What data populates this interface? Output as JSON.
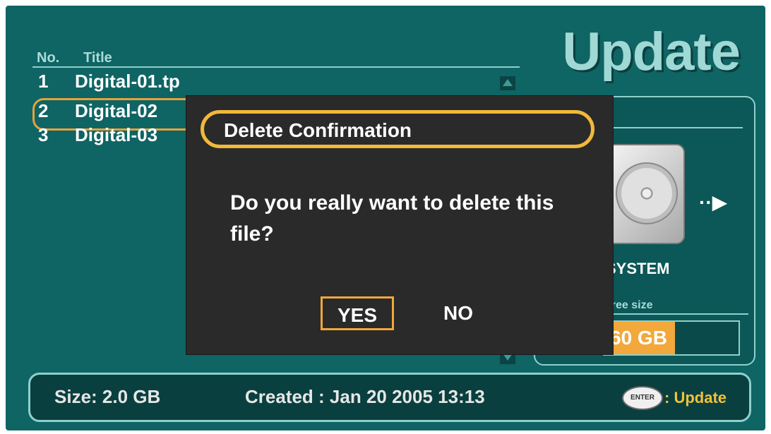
{
  "header": {
    "title": "Update"
  },
  "list": {
    "col_no": "No.",
    "col_title": "Title",
    "items": [
      {
        "no": "1",
        "title": "Digital-01.tp"
      },
      {
        "no": "2",
        "title": "Digital-02"
      },
      {
        "no": "3",
        "title": "Digital-03"
      }
    ],
    "selected_index": 1
  },
  "panel": {
    "device_label": "SYSTEM",
    "free_size_label": "Free size",
    "free_size_value": "60 GB",
    "accent": "#f2a83a"
  },
  "footer": {
    "size": "Size: 2.0 GB",
    "created": "Created : Jan 20 2005 13:13",
    "enter_label": "ENTER",
    "action_label": ": Update"
  },
  "dialog": {
    "title": "Delete Confirmation",
    "message": "Do you really want to delete this file?",
    "yes_label": "YES",
    "no_label": "NO",
    "selected": "YES"
  },
  "colors": {
    "background": "#0f6464",
    "highlight": "#f2b83a",
    "dialog_bg": "#2a2a2a"
  }
}
